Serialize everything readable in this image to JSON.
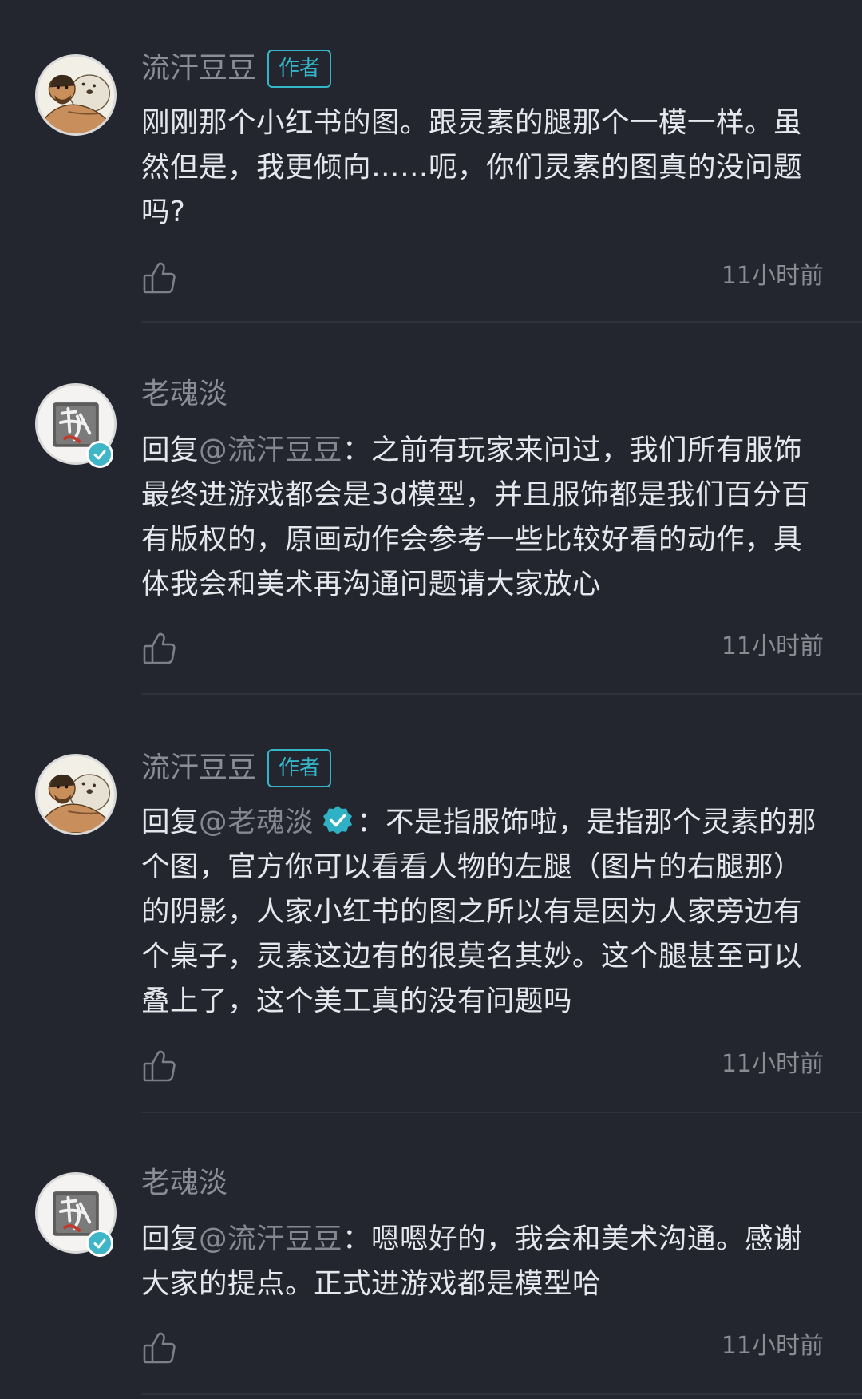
{
  "comments": [
    {
      "username": "流汗豆豆",
      "author_tag": "作者",
      "avatar": "cartoon-man-with-bear-avatar",
      "content": "刚刚那个小红书的图。跟灵素的腿那个一模一样。虽然但是，我更倾向……呃，你们灵素的图真的没问题吗?",
      "time": "11小时前"
    },
    {
      "username": "老魂淡",
      "avatar": "calligraphy-shen-avatar",
      "verified": true,
      "reply_prefix": "回复",
      "reply_to": "@流汗豆豆",
      "reply_sep": "：",
      "content": "之前有玩家来问过，我们所有服饰最终进游戏都会是3d模型，并且服饰都是我们百分百有版权的，原画动作会参考一些比较好看的动作，具体我会和美术再沟通问题请大家放心",
      "time": "11小时前"
    },
    {
      "username": "流汗豆豆",
      "author_tag": "作者",
      "avatar": "cartoon-man-with-bear-avatar",
      "reply_prefix": "回复",
      "reply_to": "@老魂淡",
      "reply_sep": "：",
      "content": "不是指服饰啦，是指那个灵素的那个图，官方你可以看看人物的左腿（图片的右腿那）的阴影，人家小红书的图之所以有是因为人家旁边有个桌子，灵素这边有的很莫名其妙。这个腿甚至可以叠上了，这个美工真的没有问题吗",
      "time": "11小时前"
    },
    {
      "username": "老魂淡",
      "avatar": "calligraphy-shen-avatar",
      "verified": true,
      "reply_prefix": "回复",
      "reply_to": "@流汗豆豆",
      "reply_sep": "：",
      "content": "嗯嗯好的，我会和美术沟通。感谢大家的提点。正式进游戏都是模型哈",
      "time": "11小时前"
    }
  ],
  "colors": {
    "background": "#23252f",
    "text": "#e6e7ec",
    "muted": "#8b8d96",
    "accent": "#34b6c8",
    "divider": "#2f313b"
  }
}
